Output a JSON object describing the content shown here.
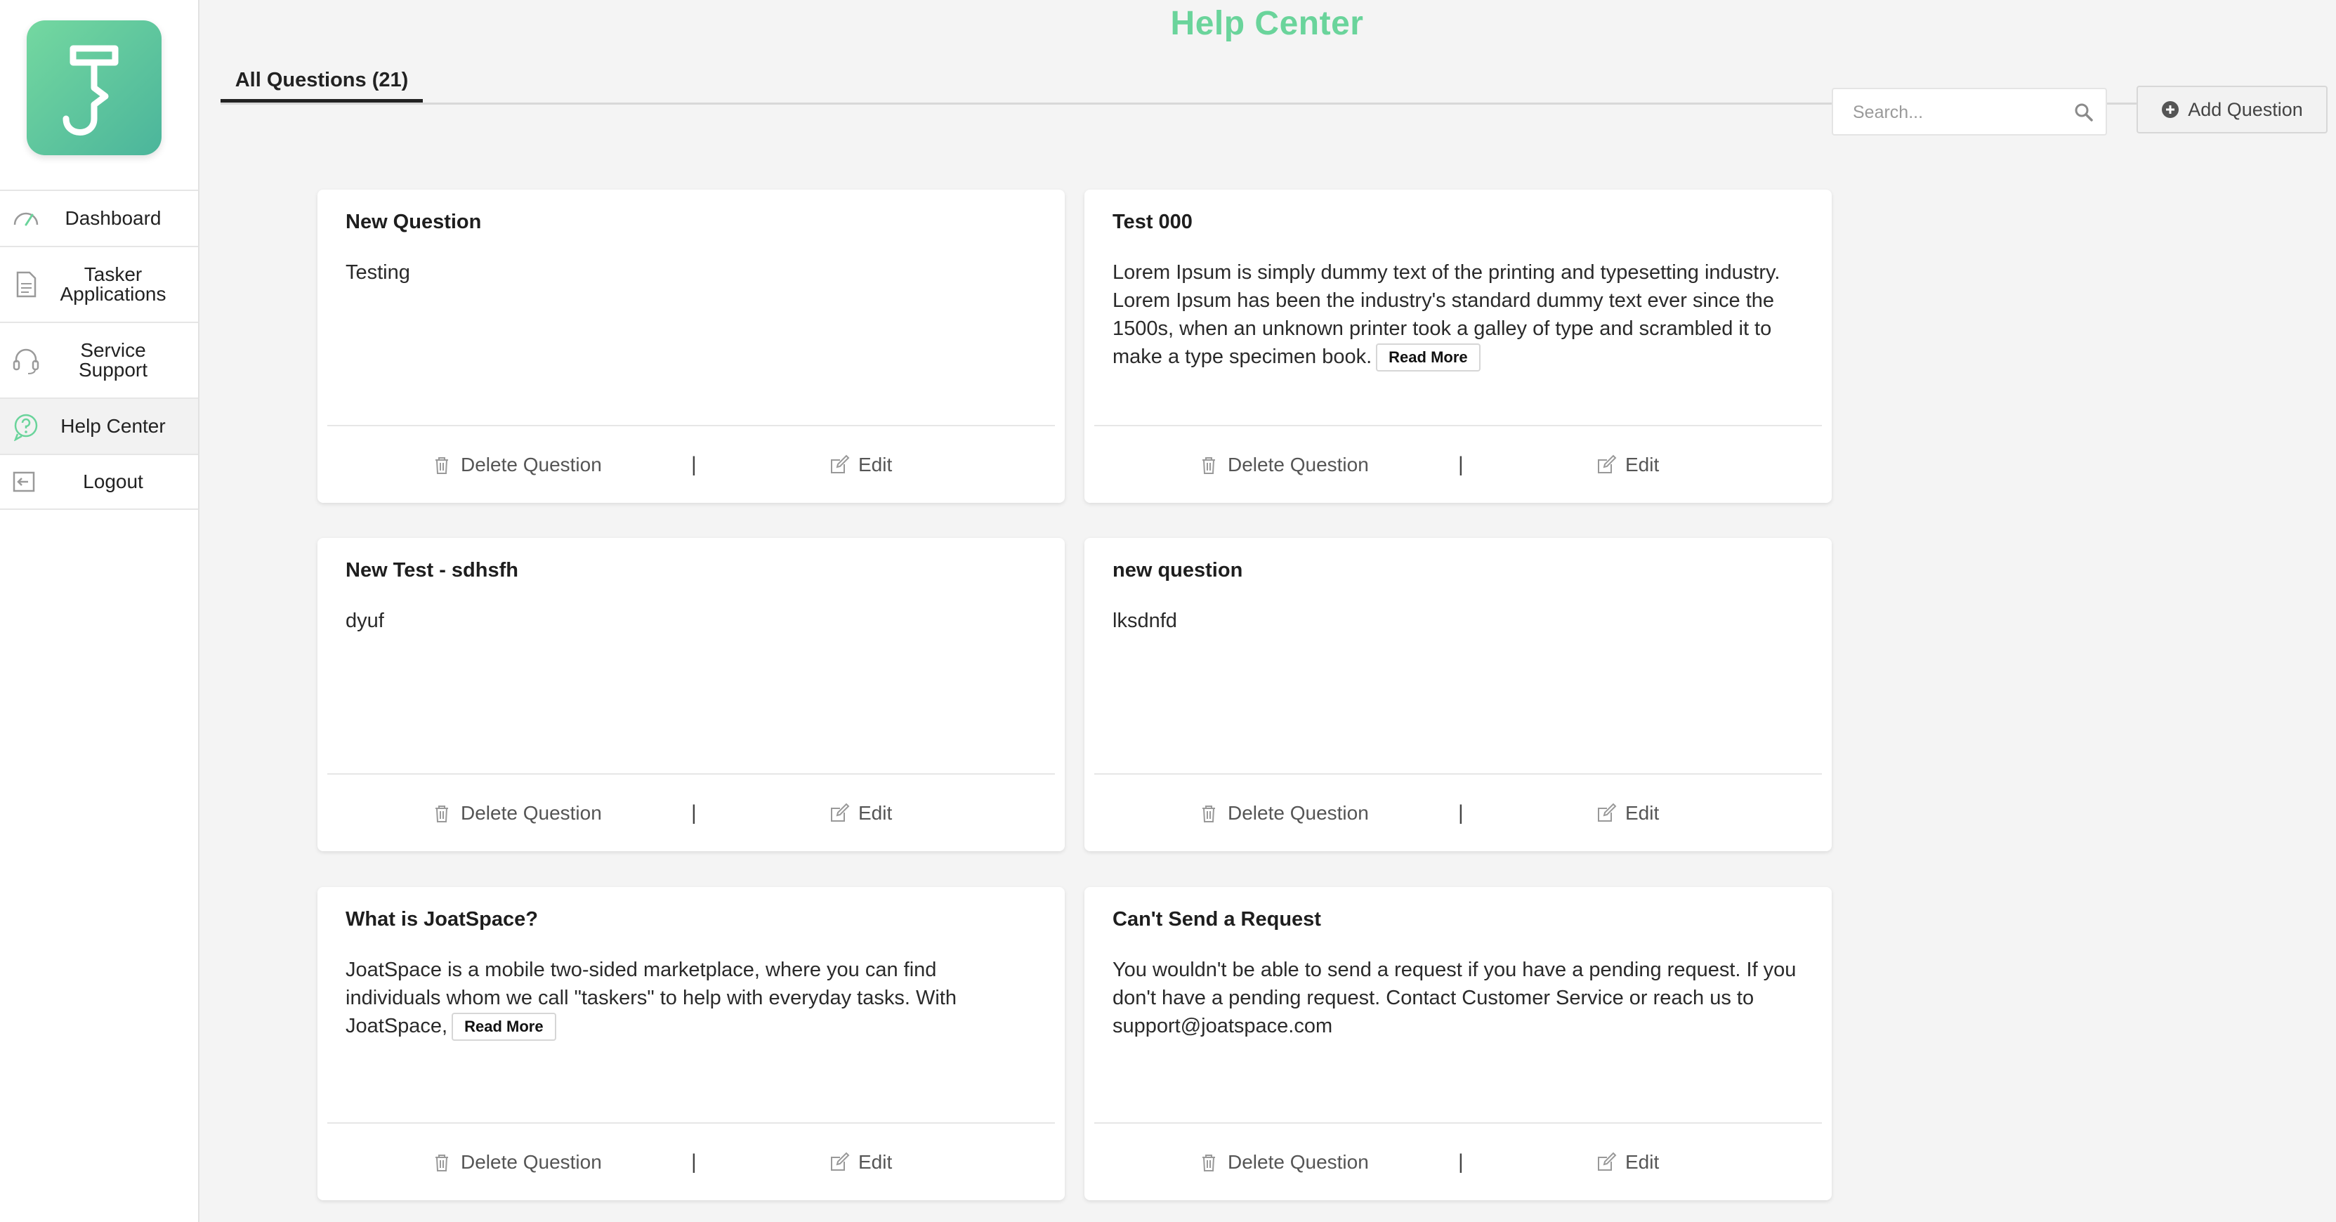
{
  "app": {
    "title": "Help Center",
    "accent_color": "#6ad49b",
    "logo_icon": "hook-logo-icon"
  },
  "sidebar": {
    "items": [
      {
        "label": "Dashboard",
        "icon": "speedometer-icon",
        "active": false
      },
      {
        "label": "Tasker\nApplications",
        "icon": "document-icon",
        "active": false
      },
      {
        "label": "Service\nSupport",
        "icon": "headset-icon",
        "active": false
      },
      {
        "label": "Help Center",
        "icon": "question-icon",
        "active": true
      },
      {
        "label": "Logout",
        "icon": "logout-icon",
        "active": false
      }
    ]
  },
  "toolbar": {
    "tab_label": "All Questions (21)",
    "search_placeholder": "Search...",
    "search_icon": "search-icon",
    "add_label": "Add Question",
    "add_icon": "plus-circle-icon"
  },
  "cards": [
    {
      "title": "New Question",
      "body": "Testing",
      "read_more": ""
    },
    {
      "title": "Test 000",
      "body": "Lorem Ipsum is simply dummy text of the printing and typesetting industry. Lorem Ipsum has been the industry's standard dummy text ever since the 1500s, when an unknown printer took a galley of type and scrambled it to make a type specimen book.",
      "read_more": "Read More"
    },
    {
      "title": "New Test - sdhsfh",
      "body": "dyuf",
      "read_more": ""
    },
    {
      "title": "new question",
      "body": "lksdnfd",
      "read_more": ""
    },
    {
      "title": "What is JoatSpace?",
      "body": "JoatSpace is a mobile two-sided marketplace, where you can find individuals whom we call \"taskers\" to help with everyday tasks. With JoatSpace,",
      "read_more": "Read More"
    },
    {
      "title": "Can't Send a Request",
      "body": "You wouldn't be able to send a request if you have a pending request. If you don't have a pending request. Contact Customer Service or reach us to support@joatspace.com",
      "read_more": ""
    }
  ],
  "card_actions": {
    "delete_label": "Delete Question",
    "separator": "|",
    "edit_label": "Edit",
    "delete_icon": "trash-icon",
    "edit_icon": "edit-icon"
  }
}
